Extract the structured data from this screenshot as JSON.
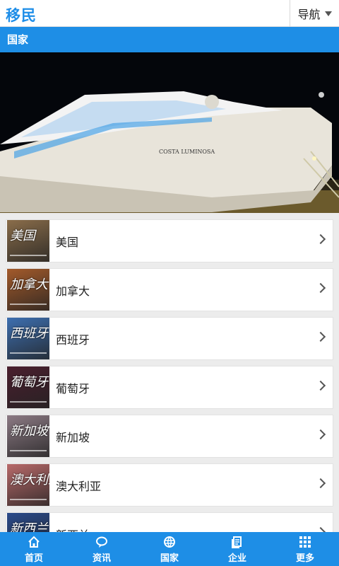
{
  "header": {
    "logo": "移民",
    "nav_label": "导航"
  },
  "section": {
    "title": "国家"
  },
  "banner": {
    "ship_name": "COSTA LUMINOSA"
  },
  "countries": [
    {
      "label": "美国",
      "thumb_text": "美国",
      "color": "#8a6d4a"
    },
    {
      "label": "加拿大",
      "thumb_text": "加拿大",
      "color": "#a35a2a"
    },
    {
      "label": "西班牙",
      "thumb_text": "西班牙",
      "color": "#3d6fb0"
    },
    {
      "label": "葡萄牙",
      "thumb_text": "葡萄牙",
      "color": "#4a1f2e"
    },
    {
      "label": "新加坡",
      "thumb_text": "新加坡",
      "color": "#8c7a84"
    },
    {
      "label": "澳大利亚",
      "thumb_text": "澳大利亚",
      "color": "#b86a6a"
    },
    {
      "label": "新西兰",
      "thumb_text": "新西兰",
      "color": "#2a4a8a"
    }
  ],
  "tabs": [
    {
      "label": "首页",
      "icon": "home-icon"
    },
    {
      "label": "资讯",
      "icon": "chat-icon"
    },
    {
      "label": "国家",
      "icon": "globe-icon"
    },
    {
      "label": "企业",
      "icon": "document-icon"
    },
    {
      "label": "更多",
      "icon": "grid-icon"
    }
  ]
}
